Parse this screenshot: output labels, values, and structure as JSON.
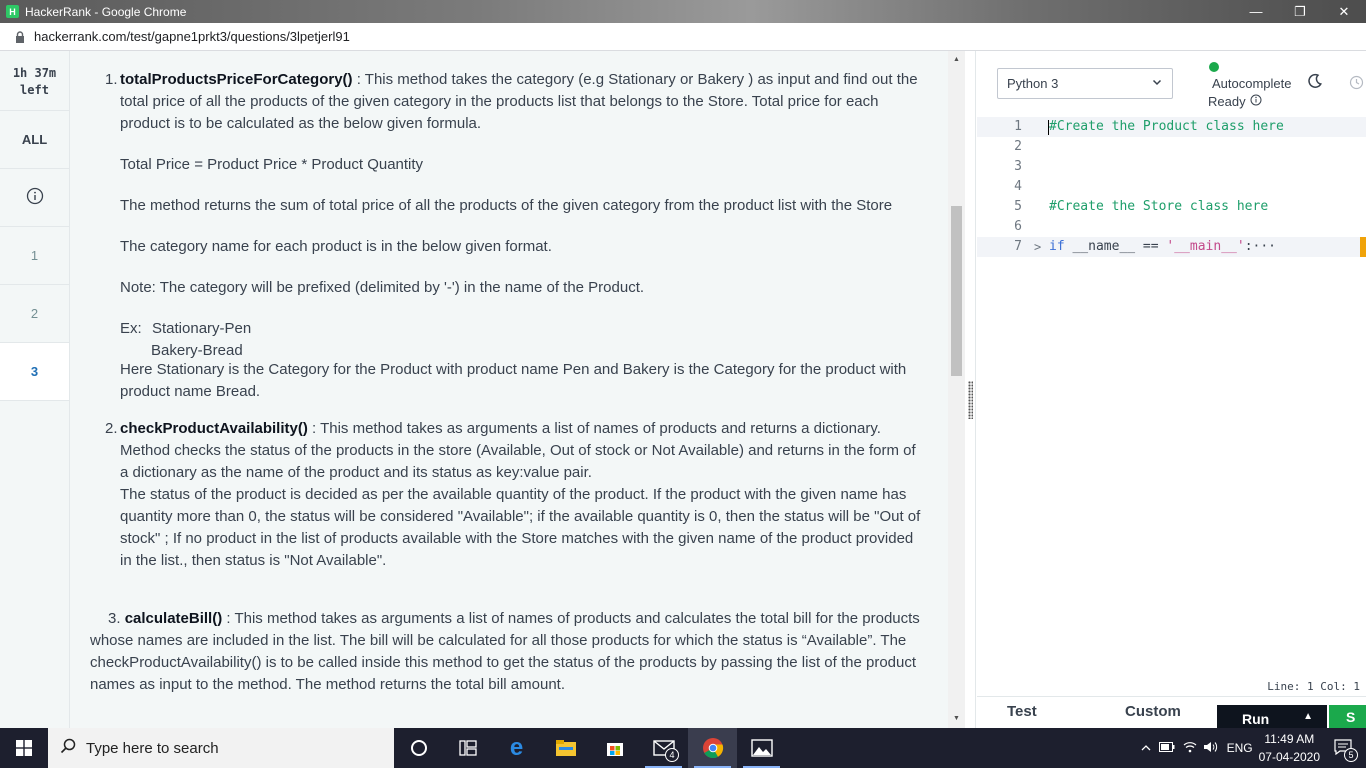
{
  "browser": {
    "window_title": "HackerRank - Google Chrome",
    "logo_letter": "H",
    "url": "hackerrank.com/test/gapne1prkt3/questions/3lpetjerl91"
  },
  "sidebar": {
    "timer_line1": "1h 37m",
    "timer_line2": "left",
    "items": [
      {
        "label": "ALL"
      },
      {
        "label": "i"
      },
      {
        "label": "1"
      },
      {
        "label": "2"
      },
      {
        "label": "3"
      }
    ]
  },
  "question": {
    "m1_num": "1.",
    "m1_name": "totalProductsPriceForCategory()",
    "m1_desc": " : This method takes the category (e.g Stationary or Bakery ) as input and find out the total price of all the products of the given category in the products list that belongs to the Store. Total price for each product is to be calculated as the below given formula.",
    "formula": "Total Price = Product Price * Product Quantity",
    "returns": "The method returns the sum of total price of all the products of the given category from the product list with the Store",
    "format_intro": "The category name for each product is in the below given format.",
    "note": "Note: The category will be prefixed (delimited by '-') in the name of the Product.",
    "ex_label": "Ex:",
    "ex1": "Stationary-Pen",
    "ex2": "Bakery-Bread",
    "here": "Here Stationary is the Category for the Product with product name Pen and Bakery is the Category for the product with product name Bread.",
    "m2_num": "2.",
    "m2_name": "checkProductAvailability()",
    "m2_desc": " : This method takes as arguments a list of names of products and returns a dictionary. Method checks the status of the products in the store (Available, Out of stock or Not Available) and returns in the form of a dictionary as the name of the product and its status as key:value pair.",
    "m2_status": "The status of the product is decided as per the available quantity of the product. If the product with the given name has quantity more than 0, the status will be considered  \"Available\"; if the available quantity is 0, then the status will be \"Out of stock\" ; If no product in the list of products available with the Store matches with the given name of the product provided in the list., then status is \"Not Available\".",
    "m3_num": "3.",
    "m3_name": "calculateBill()",
    "m3_desc": " : This method takes as arguments a list of names of products and calculates the total bill for the products whose names are included in the list. The bill will be calculated for all     those products for which the status is “Available”. The checkProductAvailability() is to be called inside this method to get the status of the products by passing the list of the product names as     input to the method. The method returns the total bill amount."
  },
  "editor": {
    "language": "Python 3",
    "autocomplete_label": "Autocomplete",
    "status": "Ready",
    "lines": [
      {
        "n": "1",
        "parts": [
          {
            "c": "cmt",
            "t": "#Create the Product class here"
          }
        ]
      },
      {
        "n": "2",
        "parts": []
      },
      {
        "n": "3",
        "parts": []
      },
      {
        "n": "4",
        "parts": []
      },
      {
        "n": "5",
        "parts": [
          {
            "c": "cmt",
            "t": "#Create the Store class here"
          }
        ]
      },
      {
        "n": "6",
        "parts": []
      },
      {
        "n": "7",
        "fold": ">",
        "parts": [
          {
            "c": "kw",
            "t": "if"
          },
          {
            "c": "plain",
            "t": " __name__ == "
          },
          {
            "c": "str",
            "t": "'__main__'"
          },
          {
            "c": "plain",
            "t": ":···"
          }
        ]
      }
    ],
    "cursor_position": "Line: 1 Col: 1",
    "tab_test": "Test",
    "tab_custom": "Custom",
    "run_label": "Run",
    "submit_label": "S"
  },
  "taskbar": {
    "search_placeholder": "Type here to search",
    "mail_badge": "4",
    "language": "ENG",
    "time": "11:49 AM",
    "date": "07-04-2020",
    "notifications": "5"
  },
  "colors": {
    "accent_green": "#1ba94c",
    "active_nav": "#1f6fb5",
    "comment": "#1e9e6a",
    "keyword": "#3b6fd6",
    "string": "#c34a8b"
  }
}
